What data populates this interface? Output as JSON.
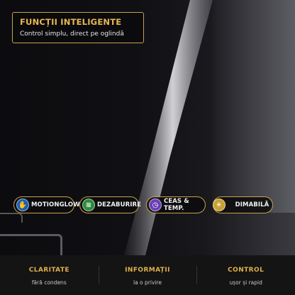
{
  "header": {
    "title": "FUNCȚII INTELIGENTE",
    "subtitle": "Control simplu, direct pe oglindă"
  },
  "features": [
    {
      "label": "MOTIONGLOW",
      "icon": "motion-hand-icon",
      "color": "#1a5fb4"
    },
    {
      "label": "DEZABURIRE",
      "icon": "defog-waves-icon",
      "color": "#2e8b3a"
    },
    {
      "label": "CEAS & TEMP.",
      "icon": "clock-icon",
      "color": "#6a3fb5"
    },
    {
      "label": "DIMABILĂ",
      "icon": "sun-dimmer-icon",
      "color": "#c9a030"
    }
  ],
  "benefits": [
    {
      "title": "CLARITATE",
      "subtitle": "fără condens"
    },
    {
      "title": "INFORMAȚII",
      "subtitle": "la o privire"
    },
    {
      "title": "CONTROL",
      "subtitle": "ușor și rapid"
    }
  ],
  "colors": {
    "accent": "#e0b04a",
    "background": "#0b0b0d",
    "bar": "#141414"
  }
}
